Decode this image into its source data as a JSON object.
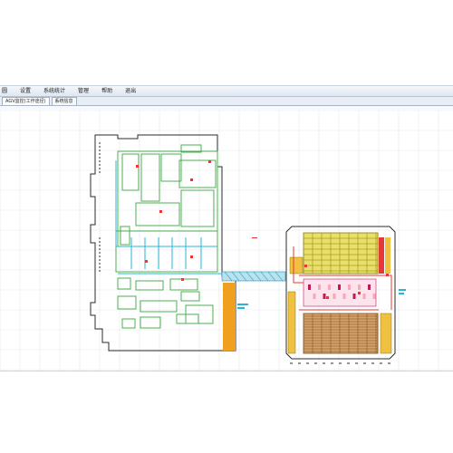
{
  "menu": {
    "items": [
      {
        "label": "圆"
      },
      {
        "label": "设置"
      },
      {
        "label": "系统统计"
      },
      {
        "label": "管理"
      },
      {
        "label": "帮助"
      },
      {
        "label": "退出"
      }
    ]
  },
  "tabs": [
    {
      "label": "AGV监控(工作途径)",
      "active": true
    },
    {
      "label": "系统信息",
      "active": false
    }
  ],
  "colors": {
    "grid": "#e4e8ee",
    "wall": "#2b2b2b",
    "zone_green": "#4caf50",
    "zone_cyan": "#29b6d6",
    "rack_yellow": "#c8b400",
    "rack_brown": "#a66a2c",
    "conveyor_orange": "#f0a020",
    "path_red": "#e53935",
    "pink": "#f8a5c2",
    "magenta": "#c2185b",
    "blue_marker": "#1e40ff"
  },
  "icons": {
    "agv": "agv-marker-icon"
  }
}
